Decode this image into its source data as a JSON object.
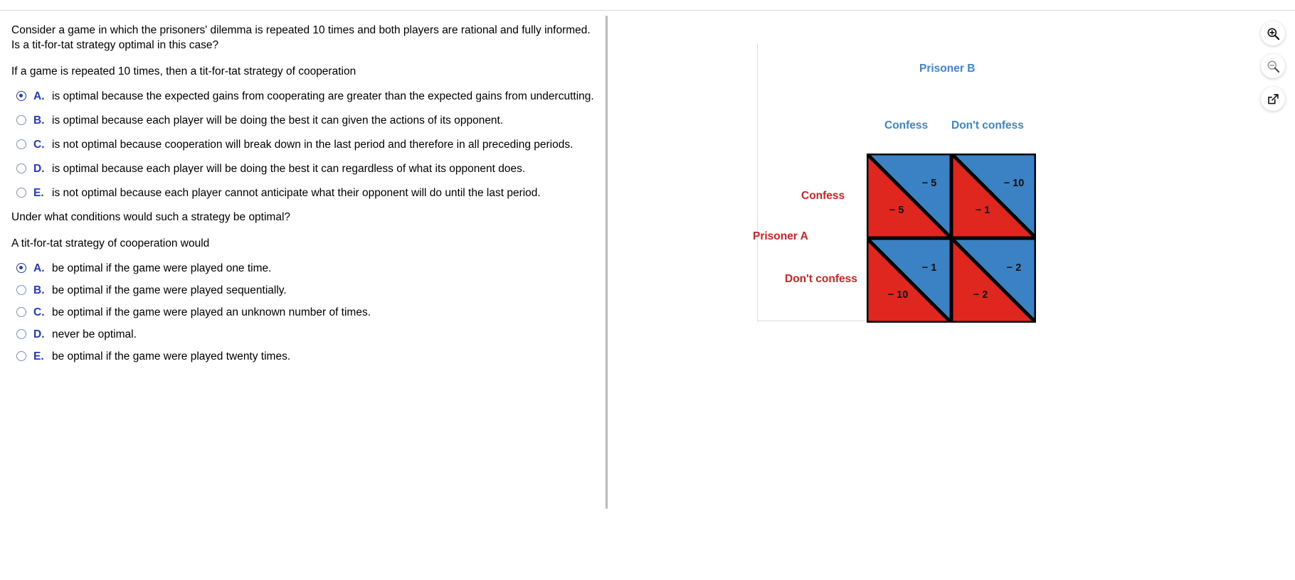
{
  "question": {
    "stem": "Consider a game in which the prisoners' dilemma is repeated 10 times and both players are rational and fully informed.  Is a tit-for-tat strategy optimal in this case?",
    "part1": {
      "lead": "If a game is repeated 10 times, then a tit-for-tat strategy of cooperation",
      "options": [
        {
          "letter": "A.",
          "text": "is optimal because the expected gains from cooperating are greater than the expected gains from undercutting.",
          "selected": true
        },
        {
          "letter": "B.",
          "text": "is optimal because each player will be doing the best it can given the actions of its opponent.",
          "selected": false
        },
        {
          "letter": "C.",
          "text": "is not optimal because cooperation will break down in the last period and therefore in all preceding periods.",
          "selected": false
        },
        {
          "letter": "D.",
          "text": "is optimal because each player will be doing the best it can regardless of what its opponent does.",
          "selected": false
        },
        {
          "letter": "E.",
          "text": "is not optimal because each player cannot anticipate what their opponent will do until the last period.",
          "selected": false
        }
      ]
    },
    "part2": {
      "prompt": "Under what conditions would such a strategy be optimal?",
      "lead": "A tit-for-tat strategy of cooperation would",
      "options": [
        {
          "letter": "A.",
          "text": "be optimal if the game were played one time.",
          "selected": true
        },
        {
          "letter": "B.",
          "text": "be optimal if the game were played sequentially.",
          "selected": false
        },
        {
          "letter": "C.",
          "text": "be optimal if the game were played an unknown number of times.",
          "selected": false
        },
        {
          "letter": "D.",
          "text": "never be optimal.",
          "selected": false
        },
        {
          "letter": "E.",
          "text": "be optimal if the game were played twenty times.",
          "selected": false
        }
      ]
    }
  },
  "figure": {
    "colors": {
      "player_a": "#d62121",
      "player_b": "#3a86d4",
      "cell_red": "#e0271f",
      "cell_blue": "#3b82c4",
      "border": "#000000"
    },
    "column_player_label": "Prisoner B",
    "row_player_label": "Prisoner A",
    "column_headers": [
      "Confess",
      "Don't confess"
    ],
    "row_headers": [
      "Confess",
      "Don't confess"
    ],
    "payoffs": {
      "confess_confess": {
        "a": "− 5",
        "b": "− 5"
      },
      "confess_dontconfess": {
        "a": "− 1",
        "b": "− 10"
      },
      "dontconfess_confess": {
        "a": "− 10",
        "b": "− 1"
      },
      "dontconfess_dontconfess": {
        "a": "− 2",
        "b": "− 2"
      }
    }
  },
  "toolbar": {
    "zoom_in_label": "zoom-in",
    "zoom_out_label": "zoom-out",
    "pop_out_label": "open-in-new-window"
  },
  "chart_data": {
    "type": "table",
    "title": "Prisoner's dilemma payoff matrix",
    "row_player": "Prisoner A",
    "column_player": "Prisoner B",
    "categories": [
      "Confess",
      "Don't confess"
    ],
    "cells": [
      {
        "row": "Confess",
        "col": "Confess",
        "a_payoff": -5,
        "b_payoff": -5
      },
      {
        "row": "Confess",
        "col": "Don't confess",
        "a_payoff": -1,
        "b_payoff": -10
      },
      {
        "row": "Don't confess",
        "col": "Confess",
        "a_payoff": -10,
        "b_payoff": -1
      },
      {
        "row": "Don't confess",
        "col": "Don't confess",
        "a_payoff": -2,
        "b_payoff": -2
      }
    ]
  }
}
